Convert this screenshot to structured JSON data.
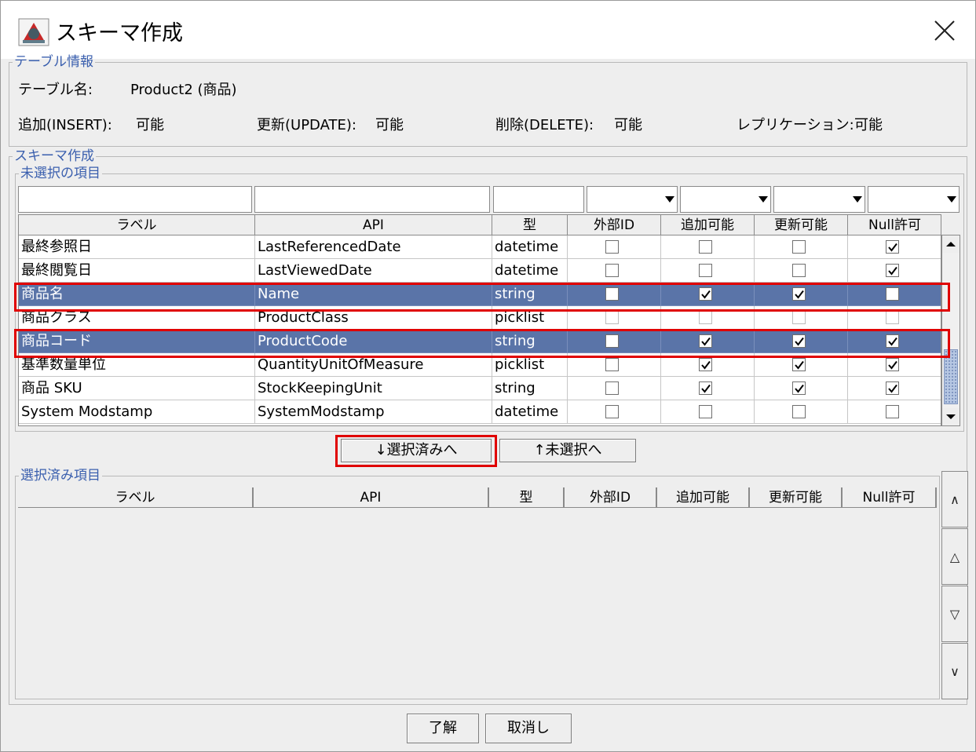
{
  "window": {
    "title": "スキーマ作成"
  },
  "table_info": {
    "legend": "テーブル情報",
    "name_label": "テーブル名:",
    "name_value": "Product2 (商品)",
    "insert_label": "追加(INSERT):",
    "insert_value": "可能",
    "update_label": "更新(UPDATE):",
    "update_value": "可能",
    "delete_label": "削除(DELETE):",
    "delete_value": "可能",
    "replication_label": "レプリケーション:",
    "replication_value": "可能"
  },
  "schema": {
    "legend": "スキーマ作成",
    "unselected_legend": "未選択の項目",
    "columns": [
      "ラベル",
      "API",
      "型",
      "外部ID",
      "追加可能",
      "更新可能",
      "Null許可"
    ],
    "rows": [
      {
        "label": "最終参照日",
        "api": "LastReferencedDate",
        "type": "datetime",
        "external_id": false,
        "creatable": false,
        "updatable": false,
        "nillable": true,
        "selected": false,
        "dim": false
      },
      {
        "label": "最終閲覧日",
        "api": "LastViewedDate",
        "type": "datetime",
        "external_id": false,
        "creatable": false,
        "updatable": false,
        "nillable": true,
        "selected": false,
        "dim": false
      },
      {
        "label": "商品名",
        "api": "Name",
        "type": "string",
        "external_id": false,
        "creatable": true,
        "updatable": true,
        "nillable": false,
        "selected": true,
        "dim": false
      },
      {
        "label": "商品クラス",
        "api": "ProductClass",
        "type": "picklist",
        "external_id": false,
        "creatable": false,
        "updatable": false,
        "nillable": false,
        "selected": false,
        "dim": true
      },
      {
        "label": "商品コード",
        "api": "ProductCode",
        "type": "string",
        "external_id": false,
        "creatable": true,
        "updatable": true,
        "nillable": true,
        "selected": true,
        "dim": false
      },
      {
        "label": "基準数量単位",
        "api": "QuantityUnitOfMeasure",
        "type": "picklist",
        "external_id": false,
        "creatable": true,
        "updatable": true,
        "nillable": true,
        "selected": false,
        "dim": false
      },
      {
        "label": "商品 SKU",
        "api": "StockKeepingUnit",
        "type": "string",
        "external_id": false,
        "creatable": true,
        "updatable": true,
        "nillable": true,
        "selected": false,
        "dim": false
      },
      {
        "label": "System Modstamp",
        "api": "SystemModstamp",
        "type": "datetime",
        "external_id": false,
        "creatable": false,
        "updatable": false,
        "nillable": false,
        "selected": false,
        "dim": false
      }
    ],
    "move_down_label": "↓選択済みへ",
    "move_up_label": "↑未選択へ",
    "selected_legend": "選択済み項目",
    "order_buttons": [
      "∧",
      "△",
      "▽",
      "∨"
    ]
  },
  "footer": {
    "ok_label": "了解",
    "cancel_label": "取消し"
  },
  "colors": {
    "selected_row": "#5a74a8",
    "highlight": "#e00000",
    "legend": "#3a5fae"
  }
}
